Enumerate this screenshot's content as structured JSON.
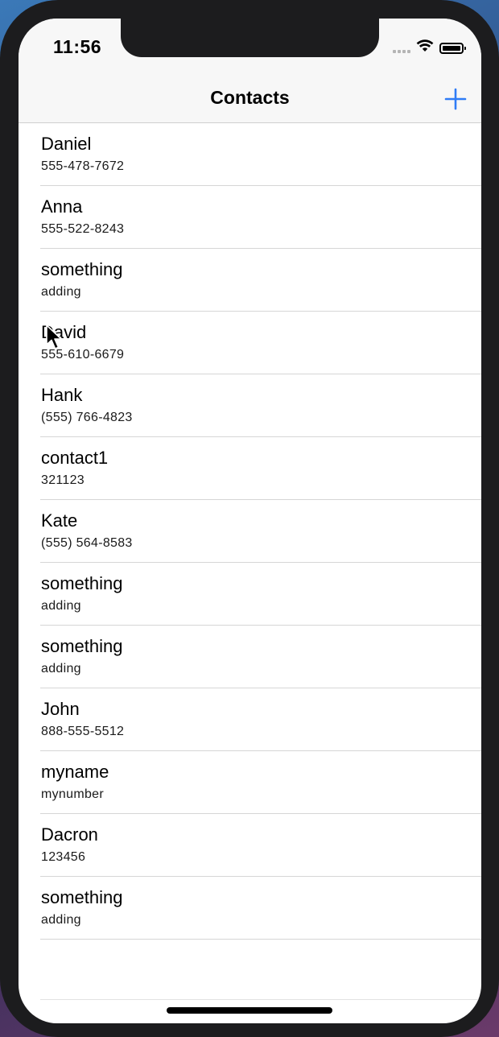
{
  "status_bar": {
    "time": "11:56"
  },
  "nav": {
    "title": "Contacts",
    "add_icon": "plus-icon"
  },
  "contacts": [
    {
      "name": "Daniel",
      "number": "555-478-7672"
    },
    {
      "name": "Anna",
      "number": "555-522-8243"
    },
    {
      "name": "something",
      "number": "adding"
    },
    {
      "name": "David",
      "number": "555-610-6679"
    },
    {
      "name": "Hank",
      "number": "(555) 766-4823"
    },
    {
      "name": "contact1",
      "number": "321123"
    },
    {
      "name": "Kate",
      "number": "(555) 564-8583"
    },
    {
      "name": "something",
      "number": "adding"
    },
    {
      "name": "something",
      "number": "adding"
    },
    {
      "name": "John",
      "number": "888-555-5512"
    },
    {
      "name": "myname",
      "number": "mynumber"
    },
    {
      "name": "Dacron",
      "number": "123456"
    },
    {
      "name": "something",
      "number": "adding"
    }
  ],
  "colors": {
    "accent": "#2f7cf6",
    "bar_background": "#f7f7f7",
    "separator": "#d6d6d6"
  }
}
